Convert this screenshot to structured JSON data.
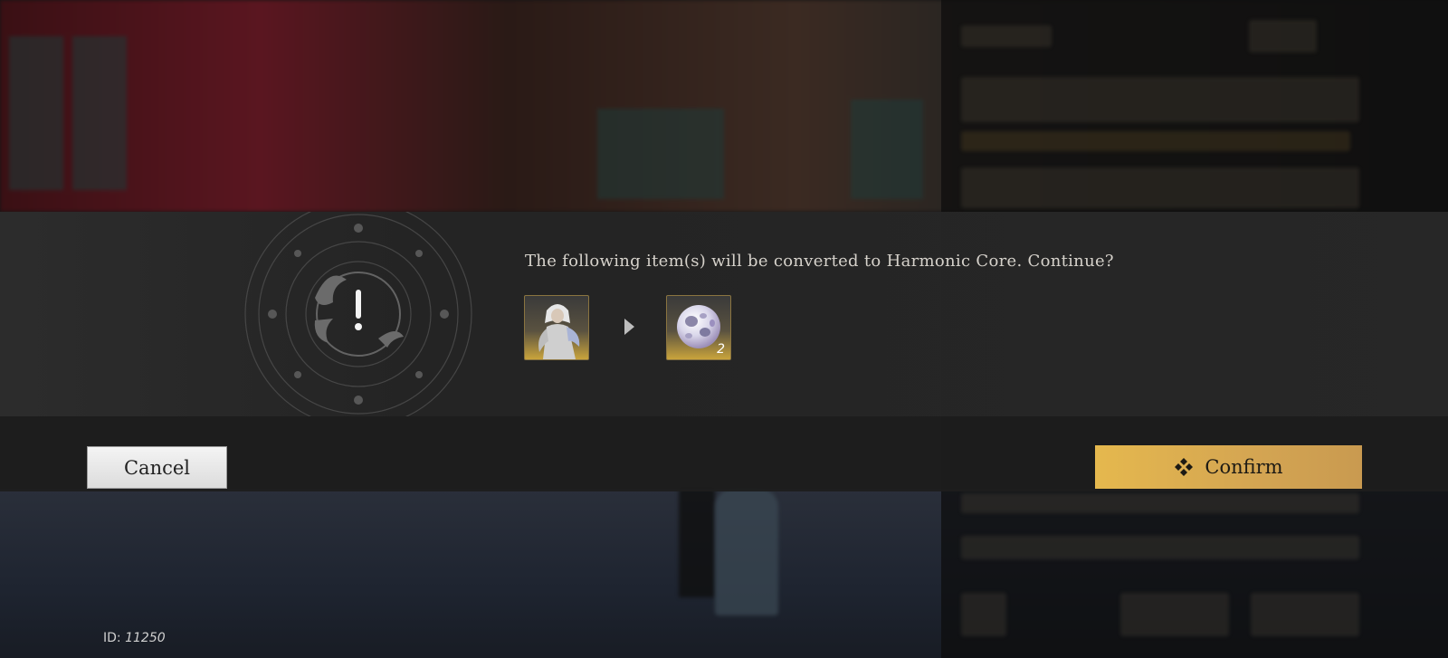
{
  "dialog": {
    "message": "The following item(s) will be converted to Harmonic Core. Continue?",
    "source_item": {
      "icon": "outfit-character-icon"
    },
    "result_item": {
      "icon": "harmonic-core-orb-icon",
      "quantity": "2"
    },
    "alert_icon": "exclamation-emblem-icon"
  },
  "buttons": {
    "cancel_label": "Cancel",
    "confirm_label": "Confirm",
    "confirm_icon": "diamond-cluster-icon"
  },
  "footer": {
    "id_prefix": "ID:",
    "id_value": "11250"
  },
  "colors": {
    "confirm_gold": "#e5b84e",
    "item_frame_gold": "#c9a43c",
    "dialog_band": "#2d2d2d"
  }
}
